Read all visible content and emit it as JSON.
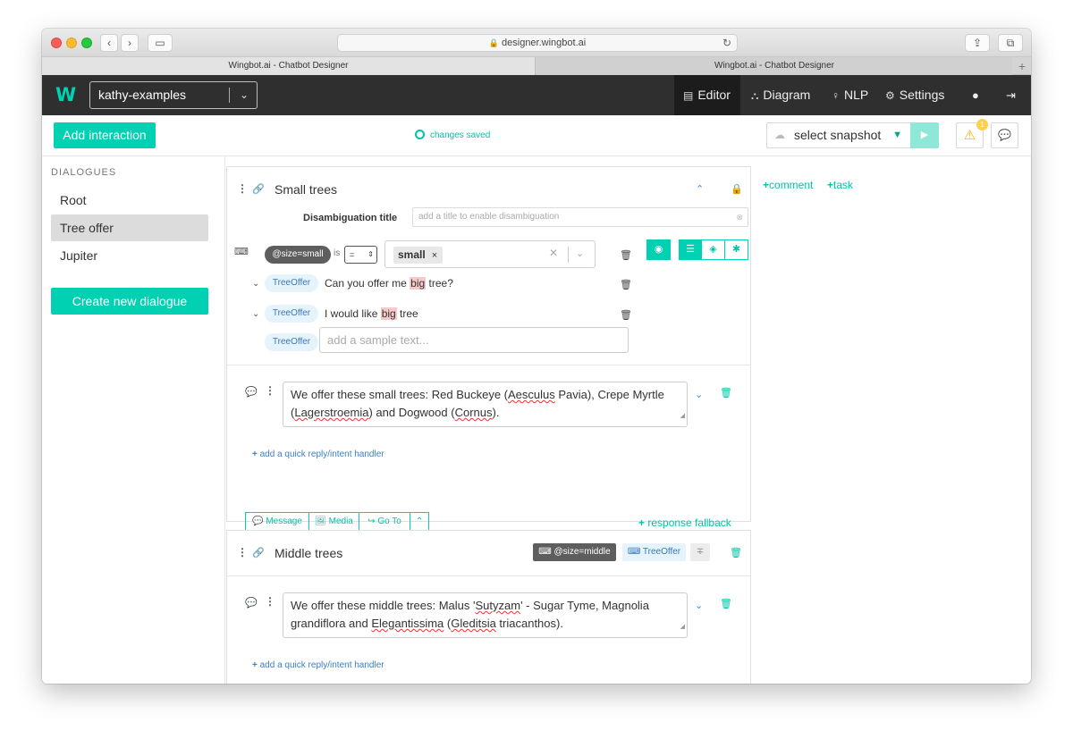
{
  "browser": {
    "url": "designer.wingbot.ai",
    "tabs": [
      "Wingbot.ai - Chatbot Designer",
      "Wingbot.ai - Chatbot Designer"
    ]
  },
  "header": {
    "logo": "W",
    "project": "kathy-examples",
    "nav": [
      "Editor",
      "Diagram",
      "NLP",
      "Settings"
    ]
  },
  "toolbar": {
    "add_interaction": "Add interaction",
    "status": "changes saved",
    "snapshot": "select snapshot",
    "warning_count": "1"
  },
  "sidebar": {
    "heading": "DIALOGUES",
    "items": [
      "Root",
      "Tree offer",
      "Jupiter"
    ],
    "active": "Tree offer",
    "create": "Create new dialogue"
  },
  "card1": {
    "title": "Small trees",
    "disamb_label": "Disambiguation title",
    "disamb_placeholder": "add a title to enable disambiguation",
    "entity": "@size=small",
    "is": "is",
    "operator": "=",
    "value": "small",
    "intent": "TreeOffer",
    "utterances": [
      {
        "pre": "Can you offer me ",
        "hl": "big",
        "post": " tree?"
      },
      {
        "pre": "I would like ",
        "hl": "big",
        "post": " tree"
      }
    ],
    "sample_placeholder": "add a sample text...",
    "response": {
      "p1": "We offer these small trees: Red Buckeye (",
      "w1": "Aesculus",
      "p2": " Pavia), Crepe Myrtle (",
      "w2": "Lagerstroemia",
      "p3": ") and Dogwood (",
      "w3": "Cornus",
      "p4": ")."
    },
    "quick_reply": "add a quick reply/intent handler",
    "segments": [
      "Message",
      "Media",
      "Go To"
    ],
    "fallback": "response fallback"
  },
  "card2": {
    "title": "Middle trees",
    "entity": "@size=middle",
    "intent": "TreeOffer",
    "response": {
      "p1": "We offer these middle trees: Malus '",
      "w1": "Sutyzam",
      "p2": "' - Sugar Tyme, Magnolia grandiflora and ",
      "w2": "Elegantissima",
      "p3": " (",
      "w3": "Gleditsia",
      "p4": " triacanthos)."
    },
    "quick_reply": "add a quick reply/intent handler"
  },
  "right_panel": {
    "comment": "comment",
    "task": "task"
  },
  "colors": {
    "accent": "#00d1b2",
    "header_bg": "#2f2f2f",
    "entity_badge": "#5e5e5e",
    "intent_badge": "#e7f3fb"
  }
}
